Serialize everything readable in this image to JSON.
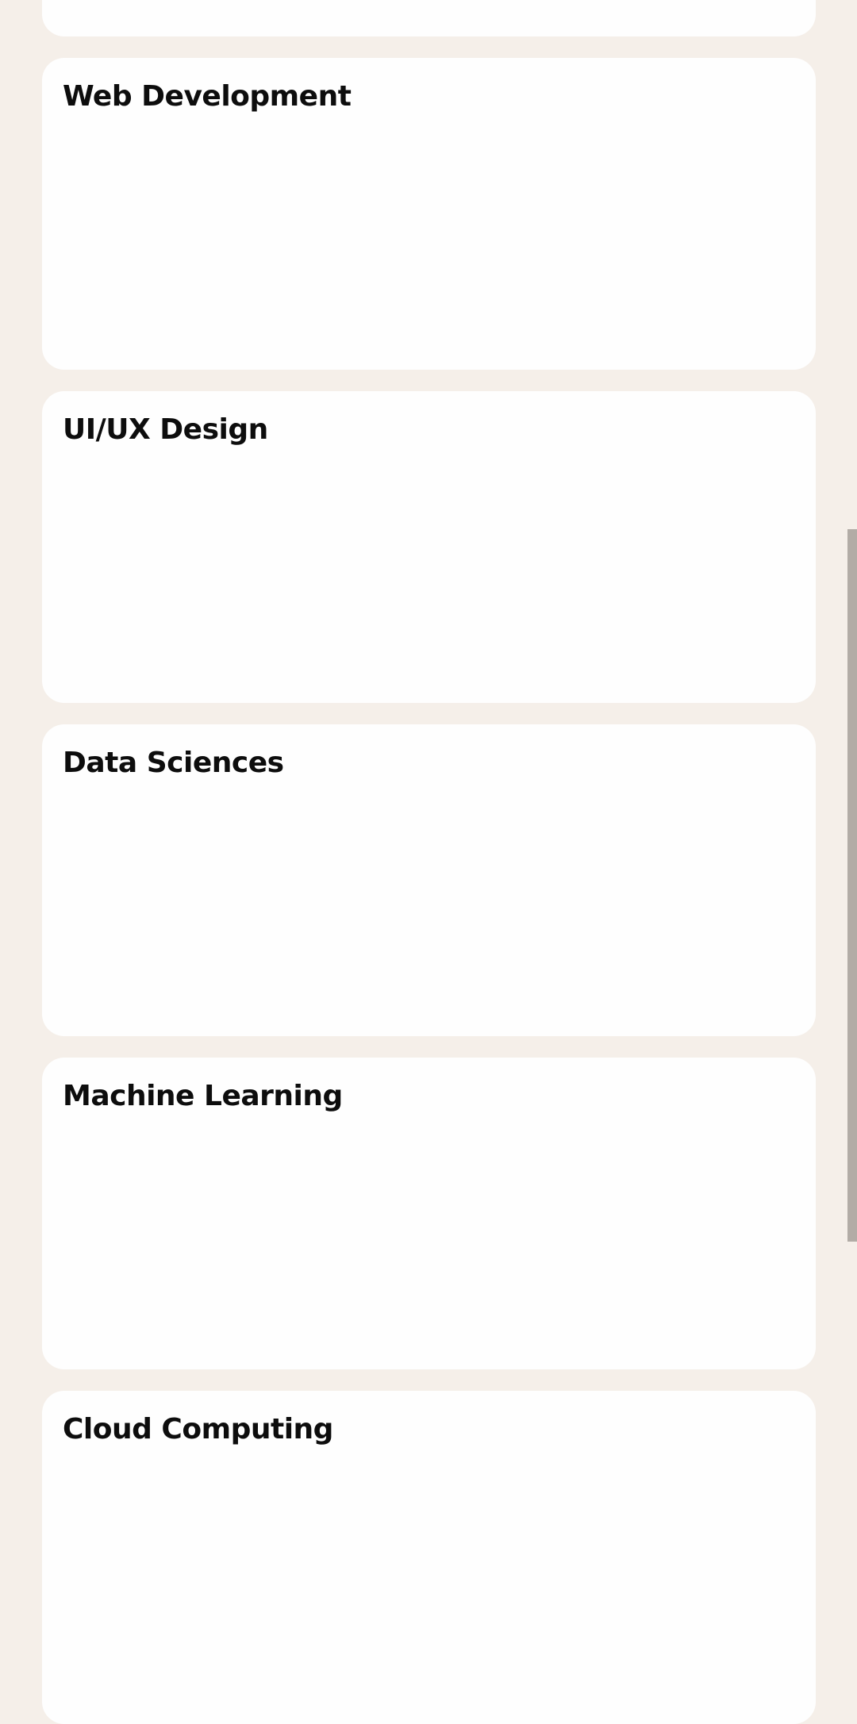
{
  "colors": {
    "background": "#f5efe9",
    "card": "#fefefe",
    "title_text": "#0d0d0d",
    "scrollbar": "#b2aca6"
  },
  "cards": [
    {
      "title": ""
    },
    {
      "title": "Web Development"
    },
    {
      "title": "UI/UX Design"
    },
    {
      "title": "Data Sciences"
    },
    {
      "title": "Machine Learning"
    },
    {
      "title": "Cloud Computing"
    }
  ]
}
